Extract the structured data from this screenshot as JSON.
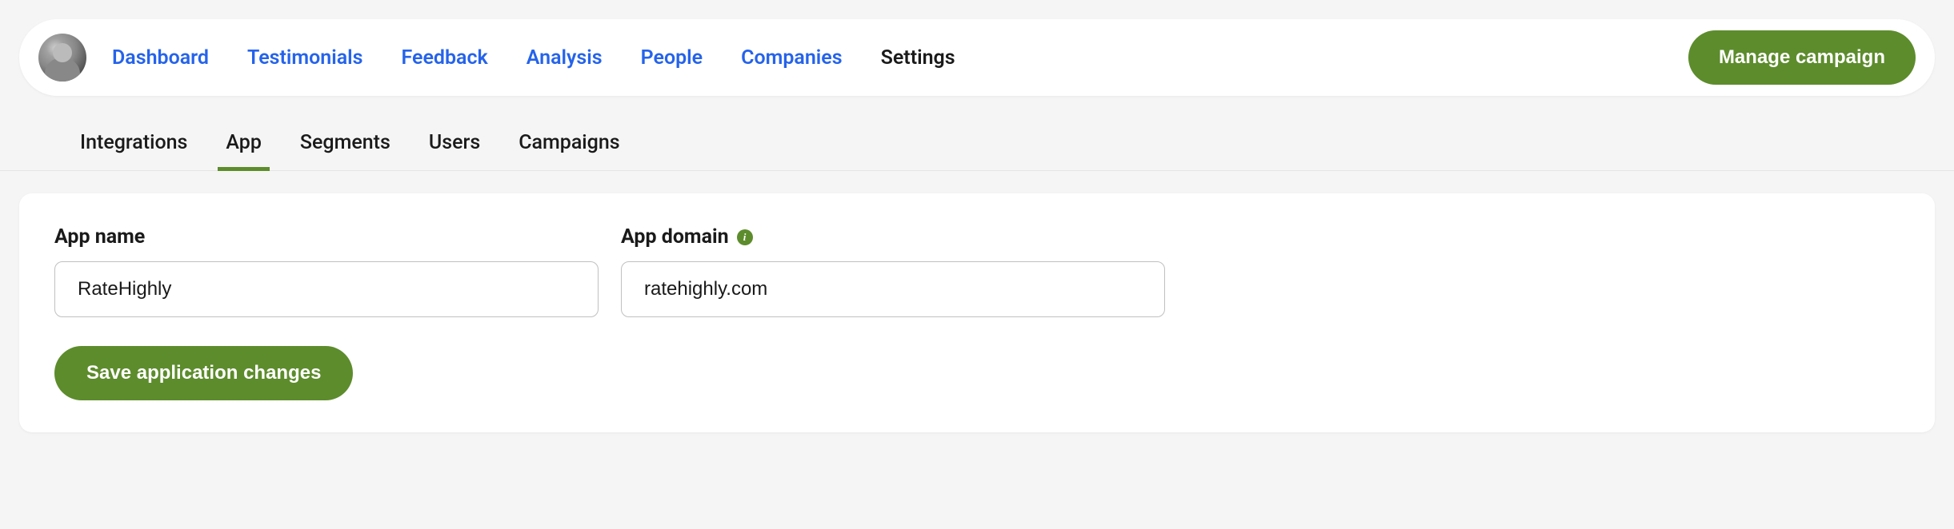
{
  "header": {
    "nav": [
      {
        "label": "Dashboard",
        "active": false
      },
      {
        "label": "Testimonials",
        "active": false
      },
      {
        "label": "Feedback",
        "active": false
      },
      {
        "label": "Analysis",
        "active": false
      },
      {
        "label": "People",
        "active": false
      },
      {
        "label": "Companies",
        "active": false
      },
      {
        "label": "Settings",
        "active": true
      }
    ],
    "manage_button": "Manage campaign"
  },
  "tabs": [
    {
      "label": "Integrations",
      "active": false
    },
    {
      "label": "App",
      "active": true
    },
    {
      "label": "Segments",
      "active": false
    },
    {
      "label": "Users",
      "active": false
    },
    {
      "label": "Campaigns",
      "active": false
    }
  ],
  "form": {
    "app_name_label": "App name",
    "app_name_value": "RateHighly",
    "app_domain_label": "App domain",
    "app_domain_value": "ratehighly.com",
    "save_button": "Save application changes"
  }
}
